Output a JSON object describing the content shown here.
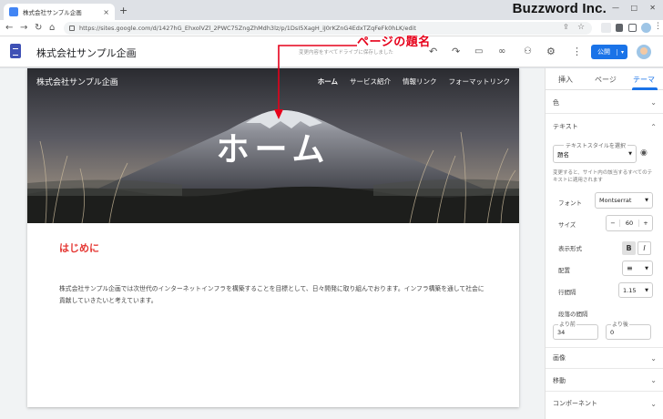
{
  "browser": {
    "tab_title": "株式会社サンプル企画",
    "url": "https://sites.google.com/d/1427hG_EhxolVZl_2PWC75ZngZhMdh3lz/p/1DsI5XagH_iJ0rKZnG4EdxTZqFeFk0hLK/edit",
    "watermark": "Buzzword Inc.",
    "new_tab": "+",
    "close": "×"
  },
  "header": {
    "doc_title": "株式会社サンプル企画",
    "saved_note": "変更内容をすべてドライブに保存しました",
    "publish_label": "公開"
  },
  "site": {
    "site_name": "株式会社サンプル企画",
    "nav": [
      "ホーム",
      "サービス紹介",
      "情報リンク",
      "フォーマットリンク"
    ],
    "page_title": "ホーム",
    "section_heading": "はじめに",
    "body_text": "株式会社サンプル企画では次世代のインターネットインフラを構築することを目標として、日々開発に取り組んでおります。インフラ構築を通して社会に貢献していきたいと考えています。"
  },
  "annotation": {
    "label": "ページの題名",
    "color": "#e6001a"
  },
  "sidebar": {
    "tabs": [
      "挿入",
      "ページ",
      "テーマ"
    ],
    "color_section": "色",
    "text_section": "テキスト",
    "text_style_label": "テキストスタイルを選択",
    "text_style_value": "題名",
    "note": "変更すると、サイト内の該当するすべてのテキストに適用されます",
    "font_label": "フォント",
    "font_value": "Montserrat",
    "size_label": "サイズ",
    "size_value": "60",
    "size_minus": "−",
    "size_plus": "+",
    "format_label": "表示形式",
    "bold": "B",
    "italic": "I",
    "align_label": "配置",
    "line_height_label": "行間隔",
    "line_height_value": "1.15",
    "para_label": "段落の間隔",
    "before_label": "より前",
    "before_value": "34",
    "after_label": "より後",
    "after_value": "0",
    "image_section": "画像",
    "move_section": "移動",
    "component_section": "コンポーネント"
  },
  "colors": {
    "accent": "#1a73e8",
    "heading_red": "#e53935",
    "annotation_red": "#e6001a"
  }
}
